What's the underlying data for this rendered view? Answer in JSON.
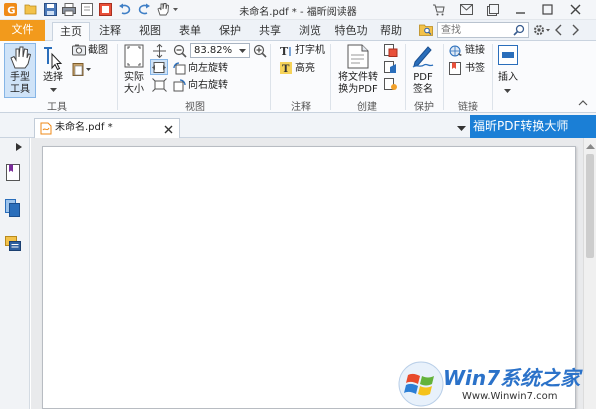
{
  "window": {
    "title": "未命名.pdf * - 福昕阅读器"
  },
  "ribbon_tabs": [
    "文件",
    "主页",
    "注释",
    "视图",
    "表单",
    "保护",
    "共享",
    "浏览",
    "特色功",
    "帮助"
  ],
  "search": {
    "placeholder": "查找"
  },
  "tools": {
    "hand": "手型\n工具",
    "select": "选择",
    "screenshot": "截图",
    "actual_size": "实际\n大小",
    "zoom_value": "83.82%",
    "rotate_left": "向左旋转",
    "rotate_right": "向右旋转",
    "typewriter": "打字机",
    "highlight": "高亮",
    "convert": "将文件转\n换为PDF",
    "pdf_sign": "PDF\n签名",
    "link": "链接",
    "bookmark": "书签",
    "insert": "插入"
  },
  "groups": {
    "tools": "工具",
    "view": "视图",
    "comment": "注释",
    "create": "创建",
    "protect": "保护",
    "links": "链接"
  },
  "document_tab": {
    "label": "未命名.pdf *"
  },
  "banner": {
    "text": "福昕PDF转换大师"
  },
  "watermark": {
    "brand": "Win7系统之家",
    "url": "Www.Winwin7.com"
  },
  "colors": {
    "file_tab": "#f29a1c",
    "banner": "#1b7fd6",
    "accent_blue": "#2a6ebb"
  }
}
